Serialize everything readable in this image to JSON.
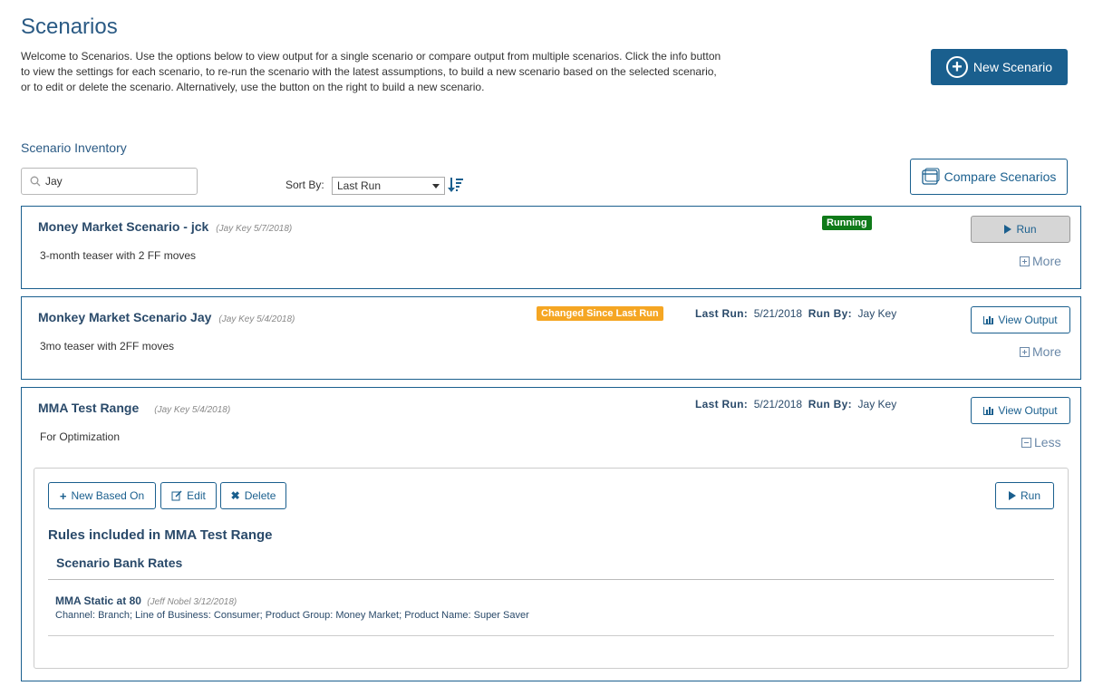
{
  "page": {
    "title": "Scenarios",
    "intro": "Welcome to Scenarios. Use the options below to view output for a single scenario or compare output from multiple scenarios. Click the info button to view the settings for each scenario, to re-run the scenario with the latest assumptions, to build a new scenario based on the selected scenario, or to edit or delete the scenario. Alternatively, use the button on the right to build a new scenario.",
    "new_scenario_label": "New Scenario"
  },
  "inventory": {
    "label": "Scenario Inventory",
    "search_value": "Jay",
    "sort_label": "Sort By:",
    "sort_value": "Last Run",
    "compare_label": "Compare Scenarios"
  },
  "scenarios": [
    {
      "name": "Money Market Scenario - jck",
      "meta": "(Jay Key 5/7/2018)",
      "description": "3-month teaser with 2 FF moves",
      "badge": "Running",
      "action_label": "Run",
      "toggle_label": "More"
    },
    {
      "name": "Monkey Market Scenario Jay",
      "meta": "(Jay Key 5/4/2018)",
      "description": "3mo teaser with 2FF moves",
      "badge": "Changed Since Last Run",
      "last_run_label": "Last Run:",
      "last_run_value": "5/21/2018",
      "run_by_label": "Run By:",
      "run_by_value": "Jay Key",
      "action_label": "View Output",
      "toggle_label": "More"
    },
    {
      "name": "MMA Test Range",
      "meta": "(Jay Key 5/4/2018)",
      "description": "For Optimization",
      "last_run_label": "Last Run:",
      "last_run_value": "5/21/2018",
      "run_by_label": "Run By:",
      "run_by_value": "Jay Key",
      "action_label": "View Output",
      "toggle_label": "Less",
      "details": {
        "new_based_on_label": "New Based On",
        "edit_label": "Edit",
        "delete_label": "Delete",
        "run_label": "Run",
        "rules_title": "Rules included in MMA Test Range",
        "group_title": "Scenario Bank Rates",
        "rule_name": "MMA Static at 80",
        "rule_meta": "(Jeff Nobel 3/12/2018)",
        "rule_detail": "Channel: Branch; Line of Business: Consumer; Product Group: Money Market; Product Name: Super Saver"
      }
    }
  ],
  "colors": {
    "primary": "#1a5f8e",
    "running": "#0f7a19",
    "changed": "#f5a623"
  }
}
